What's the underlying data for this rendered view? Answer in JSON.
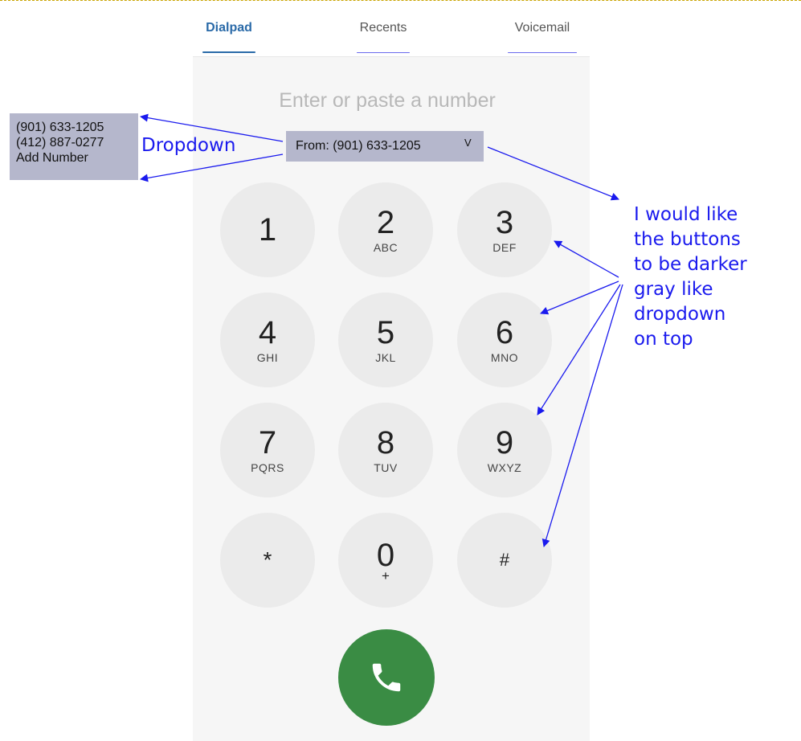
{
  "tabs": [
    {
      "label": "Dialpad"
    },
    {
      "label": "Recents"
    },
    {
      "label": "Voicemail"
    }
  ],
  "number_input": {
    "placeholder": "Enter or paste a number",
    "value": ""
  },
  "from_dropdown": {
    "label": "From: (901) 633-1205",
    "chevron": "V"
  },
  "dropdown_options": [
    "(901) 633-1205",
    "(412) 887-0277",
    "Add Number"
  ],
  "keys": [
    {
      "digit": "1",
      "letters": ""
    },
    {
      "digit": "2",
      "letters": "ABC"
    },
    {
      "digit": "3",
      "letters": "DEF"
    },
    {
      "digit": "4",
      "letters": "GHI"
    },
    {
      "digit": "5",
      "letters": "JKL"
    },
    {
      "digit": "6",
      "letters": "MNO"
    },
    {
      "digit": "7",
      "letters": "PQRS"
    },
    {
      "digit": "8",
      "letters": "TUV"
    },
    {
      "digit": "9",
      "letters": "WXYZ"
    },
    {
      "digit": "*",
      "letters": ""
    },
    {
      "digit": "0",
      "letters": "+"
    },
    {
      "digit": "#",
      "letters": ""
    }
  ],
  "call_button": {
    "icon": "phone-icon"
  },
  "annotations": {
    "dropdown_label": "Dropdown",
    "note_lines": [
      "I would like",
      "the buttons",
      "to be darker",
      "gray like",
      "dropdown",
      "on top"
    ]
  },
  "colors": {
    "accent": "#2a6aa8",
    "annotation": "#1a1aee",
    "dropdown_bg": "#b5b7cc",
    "key_bg": "#ebebeb",
    "call_green": "#3a8c44"
  }
}
